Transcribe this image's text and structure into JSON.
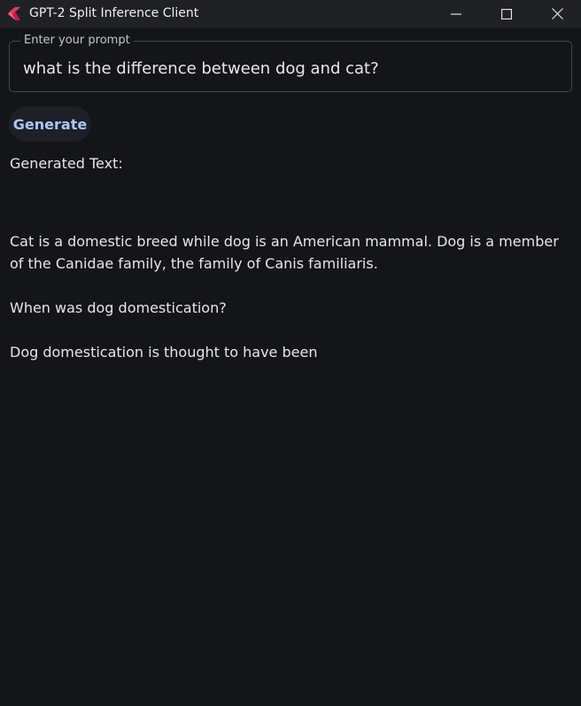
{
  "window": {
    "title": "GPT-2 Split Inference Client",
    "icons": {
      "app": "flutter-app-icon",
      "minimize": "minimize-icon",
      "maximize": "maximize-icon",
      "close": "close-icon"
    }
  },
  "prompt": {
    "label": "Enter your prompt",
    "value": "what is the difference between dog and cat?"
  },
  "generate_button": {
    "label": "Generate"
  },
  "output": {
    "heading": "Generated Text:",
    "paragraphs": [
      "Cat is a domestic breed while dog is an American mammal. Dog is a member of the Canidae family, the family of Canis familiaris.",
      "When was dog domestication?",
      "Dog domestication is thought to have been"
    ]
  },
  "colors": {
    "background": "#131519",
    "titlebar": "#1f2125",
    "accent": "#a7c8f8",
    "border": "#44474d"
  }
}
